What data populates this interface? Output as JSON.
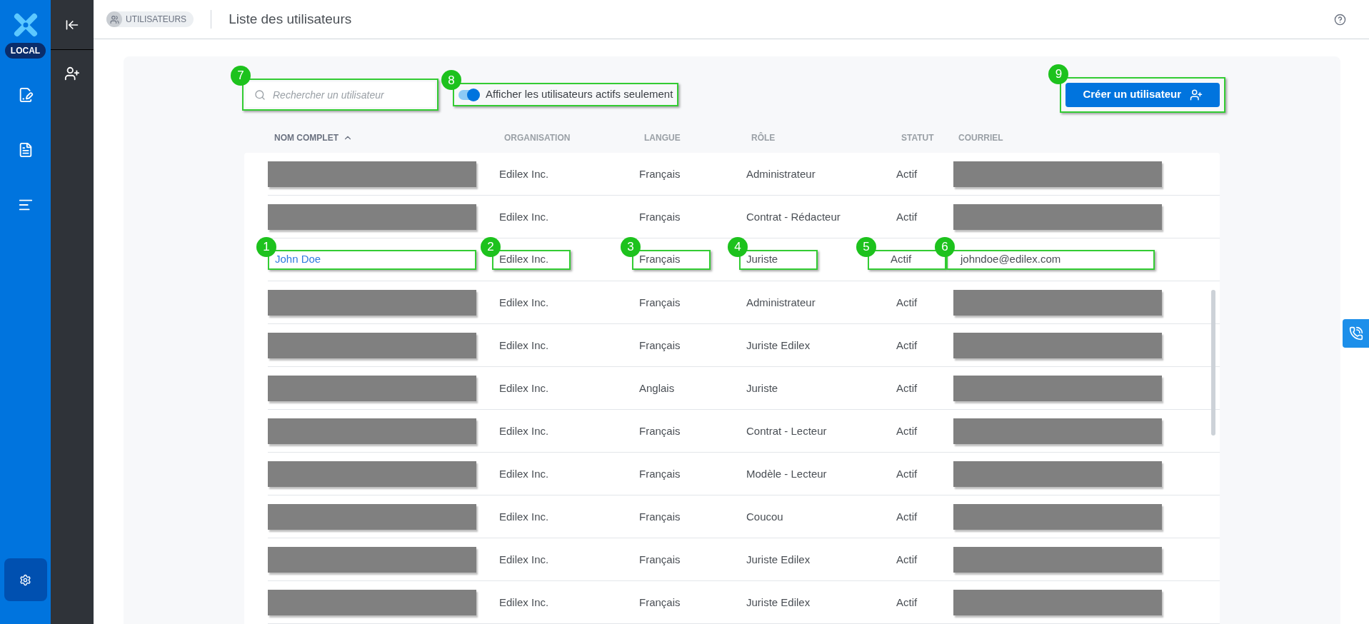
{
  "rail": {
    "badge": "LOCAL"
  },
  "header": {
    "breadcrumb": "UTILISATEURS",
    "title": "Liste des utilisateurs"
  },
  "search": {
    "placeholder": "Rechercher un utilisateur",
    "callout": "7"
  },
  "toggle": {
    "label": "Afficher les utilisateurs actifs seulement",
    "on": true,
    "callout": "8"
  },
  "create_button": {
    "label": "Créer un utilisateur",
    "callout": "9"
  },
  "table": {
    "columns": [
      {
        "label": "NOM COMPLET",
        "sorted": true
      },
      {
        "label": "ORGANISATION",
        "sorted": false
      },
      {
        "label": "LANGUE",
        "sorted": false
      },
      {
        "label": "RÔLE",
        "sorted": false
      },
      {
        "label": "STATUT",
        "sorted": false
      },
      {
        "label": "COURRIEL",
        "sorted": false
      }
    ],
    "rows": [
      {
        "name": {
          "redacted": true
        },
        "organisation": {
          "text": "Edilex Inc."
        },
        "langue": {
          "text": "Français"
        },
        "role": {
          "text": "Administrateur"
        },
        "statut": {
          "text": "Actif"
        },
        "courriel": {
          "redacted": true
        }
      },
      {
        "name": {
          "redacted": true
        },
        "organisation": {
          "text": "Edilex Inc."
        },
        "langue": {
          "text": "Français"
        },
        "role": {
          "text": "Contrat - Rédacteur"
        },
        "statut": {
          "text": "Actif"
        },
        "courriel": {
          "redacted": true
        }
      },
      {
        "name": {
          "text": "John Doe",
          "callout": "1"
        },
        "organisation": {
          "text": "Edilex Inc.",
          "callout": "2"
        },
        "langue": {
          "text": "Français",
          "callout": "3"
        },
        "role": {
          "text": "Juriste",
          "callout": "4"
        },
        "statut": {
          "text": "Actif",
          "callout": "5"
        },
        "courriel": {
          "text": "johndoe@edilex.com",
          "callout": "6"
        }
      },
      {
        "name": {
          "redacted": true
        },
        "organisation": {
          "text": "Edilex Inc."
        },
        "langue": {
          "text": "Français"
        },
        "role": {
          "text": "Administrateur"
        },
        "statut": {
          "text": "Actif"
        },
        "courriel": {
          "redacted": true
        }
      },
      {
        "name": {
          "redacted": true
        },
        "organisation": {
          "text": "Edilex Inc."
        },
        "langue": {
          "text": "Français"
        },
        "role": {
          "text": "Juriste Edilex"
        },
        "statut": {
          "text": "Actif"
        },
        "courriel": {
          "redacted": true
        }
      },
      {
        "name": {
          "redacted": true
        },
        "organisation": {
          "text": "Edilex Inc."
        },
        "langue": {
          "text": "Anglais"
        },
        "role": {
          "text": "Juriste"
        },
        "statut": {
          "text": "Actif"
        },
        "courriel": {
          "redacted": true
        }
      },
      {
        "name": {
          "redacted": true
        },
        "organisation": {
          "text": "Edilex Inc."
        },
        "langue": {
          "text": "Français"
        },
        "role": {
          "text": "Contrat - Lecteur"
        },
        "statut": {
          "text": "Actif"
        },
        "courriel": {
          "redacted": true
        }
      },
      {
        "name": {
          "redacted": true
        },
        "organisation": {
          "text": "Edilex Inc."
        },
        "langue": {
          "text": "Français"
        },
        "role": {
          "text": "Modèle - Lecteur"
        },
        "statut": {
          "text": "Actif"
        },
        "courriel": {
          "redacted": true
        }
      },
      {
        "name": {
          "redacted": true
        },
        "organisation": {
          "text": "Edilex Inc."
        },
        "langue": {
          "text": "Français"
        },
        "role": {
          "text": "Coucou"
        },
        "statut": {
          "text": "Actif"
        },
        "courriel": {
          "redacted": true
        }
      },
      {
        "name": {
          "redacted": true
        },
        "organisation": {
          "text": "Edilex Inc."
        },
        "langue": {
          "text": "Français"
        },
        "role": {
          "text": "Juriste Edilex"
        },
        "statut": {
          "text": "Actif"
        },
        "courriel": {
          "redacted": true
        }
      },
      {
        "name": {
          "redacted": true
        },
        "organisation": {
          "text": "Edilex Inc."
        },
        "langue": {
          "text": "Français"
        },
        "role": {
          "text": "Juriste Edilex"
        },
        "statut": {
          "text": "Actif"
        },
        "courriel": {
          "redacted": true
        }
      }
    ]
  }
}
